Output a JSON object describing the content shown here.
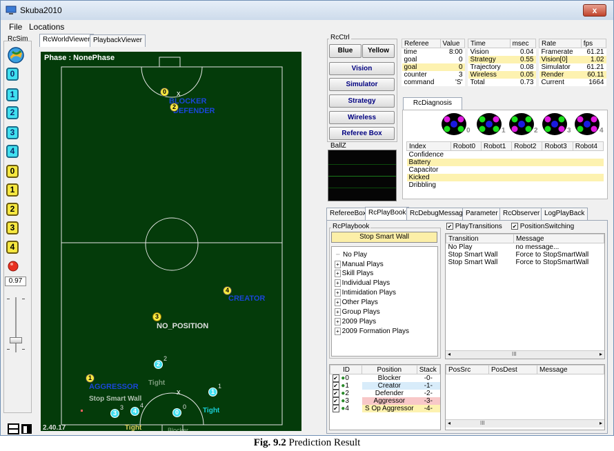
{
  "window": {
    "title": "Skuba2010",
    "close": "x"
  },
  "menu": {
    "file": "File",
    "locations": "Locations"
  },
  "left_tabs": {
    "sim": "RcSim",
    "world": "RcWorldViewer",
    "playback": "PlaybackViewer"
  },
  "sim": {
    "blue_buttons": [
      "0",
      "1",
      "2",
      "3",
      "4"
    ],
    "yellow_buttons": [
      "0",
      "1",
      "2",
      "3",
      "4"
    ],
    "speed_value": "0.97"
  },
  "field": {
    "phase": "Phase : NonePhase",
    "version": "2.40.17",
    "labels": {
      "blocker": "BLOCKER",
      "defender": "DEFENDER",
      "creator": "CREATOR",
      "no_position": "NO_POSITION",
      "aggressor": "AGGRESSOR",
      "tight1": "Tight",
      "tight2": "Tight",
      "tight3": "Tight",
      "stop_wall": "Stop Smart Wall",
      "extra": "Blocker"
    },
    "robots": {
      "y0": "0",
      "y2": "2",
      "y4": "4",
      "y3": "3",
      "y1": "1",
      "b2": "2",
      "b1": "1",
      "b3": "3",
      "b4": "4",
      "b0": "0"
    },
    "robot_sub": {
      "b2": "2",
      "b1": "1",
      "b3": "3",
      "b4": "4",
      "b0": "0"
    }
  },
  "rcctrl": {
    "label": "RcCtrl",
    "blue": "Blue",
    "yellow": "Yellow",
    "vision": "Vision",
    "simulator": "Simulator",
    "strategy": "Strategy",
    "wireless": "Wireless",
    "referee_box": "Referee Box",
    "ballz": "BallZ"
  },
  "referee_table": {
    "headers": [
      "Referee",
      "Value"
    ],
    "rows": [
      [
        "time",
        "8:00"
      ],
      [
        "goal",
        "0"
      ],
      [
        "goal",
        "0"
      ],
      [
        "counter",
        "3"
      ],
      [
        "command",
        "'S'"
      ]
    ]
  },
  "time_table": {
    "headers": [
      "Time",
      "msec"
    ],
    "rows": [
      [
        "Vision",
        "0.04"
      ],
      [
        "Strategy",
        "0.55"
      ],
      [
        "Trajectory",
        "0.08"
      ],
      [
        "Wireless",
        "0.05"
      ],
      [
        "Total",
        "0.73"
      ]
    ]
  },
  "rate_table": {
    "headers": [
      "Rate",
      "fps"
    ],
    "rows": [
      [
        "Framerate",
        "61.21"
      ],
      [
        "Vision[0]",
        "1.02"
      ],
      [
        "Simulator",
        "61.21"
      ],
      [
        "Render",
        "60.11"
      ],
      [
        "Current",
        "1664"
      ]
    ]
  },
  "diagnosis": {
    "tab": "RcDiagnosis",
    "robot_numbers": [
      "0",
      "1",
      "2",
      "3",
      "4"
    ],
    "headers": [
      "Index",
      "Robot0",
      "Robot1",
      "Robot2",
      "Robot3",
      "Robot4"
    ],
    "rows": [
      "Confidence",
      "Battery",
      "Capacitor",
      "Kicked",
      "Dribbling"
    ]
  },
  "right_tabs": [
    "RefereeBox",
    "RcPlayBook",
    "RcDebugMessage",
    "Parameter",
    "RcObserver",
    "LogPlayBack"
  ],
  "playbook": {
    "label": "RcPlaybook",
    "current_play": "Stop Smart Wall",
    "tree": [
      "No Play",
      "Manual Plays",
      "Skill Plays",
      "Individual Plays",
      "Intimidation Plays",
      "Other Plays",
      "Group Plays",
      "2009 Plays",
      "2009 Formation Plays"
    ]
  },
  "transitions": {
    "play_transitions": "PlayTransitions",
    "position_switching": "PositionSwitching",
    "headers": [
      "Transition",
      "Message"
    ],
    "rows": [
      [
        "No Play",
        "no message..."
      ],
      [
        "Stop Smart Wall",
        "Force to StopSmartWall"
      ],
      [
        "Stop Smart Wall",
        "Force to StopSmartWall"
      ]
    ],
    "scroll_dots": "III"
  },
  "positions": {
    "headers": [
      "ID",
      "Position",
      "Stack"
    ],
    "rows": [
      [
        "0",
        "Blocker",
        "-0-"
      ],
      [
        "1",
        "Creator",
        "-1-"
      ],
      [
        "2",
        "Defender",
        "-2-"
      ],
      [
        "3",
        "Aggressor",
        "-3-"
      ],
      [
        "4",
        "S Op Aggressor",
        "-4-"
      ]
    ],
    "check": "✔"
  },
  "possrc": {
    "headers": [
      "PosSrc",
      "PosDest",
      "Message"
    ],
    "scroll_dots": "III"
  },
  "caption": {
    "bold": "Fig. 9.2",
    "rest": " Prediction Result"
  },
  "colors": {
    "field": "#043b0a",
    "blue_robot": "#40e0f0",
    "yellow_robot": "#f6e840",
    "highlight_row": "#fdf2b0"
  }
}
